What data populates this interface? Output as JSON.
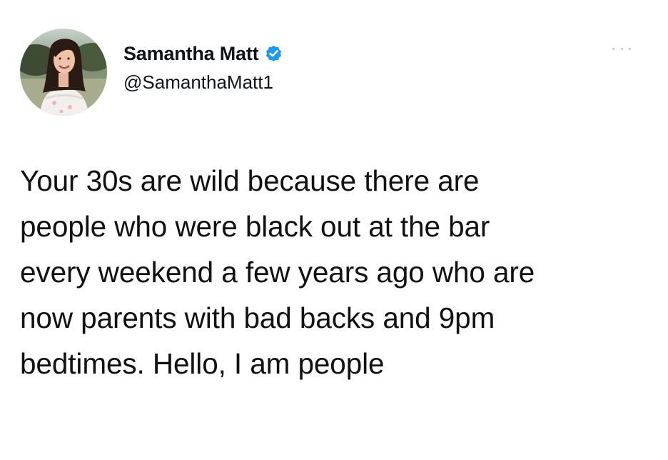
{
  "author": {
    "display_name": "Samantha Matt",
    "handle": "@SamanthaMatt1",
    "verified": true,
    "avatar_icon": "profile-photo",
    "verified_icon": "verified-badge-icon",
    "verified_color": "#1d9bf0"
  },
  "menu": {
    "icon": "more-options-icon"
  },
  "tweet": {
    "lines": [
      "Your 30s are wild because there are",
      "people who were black out at the bar",
      "every weekend a few years ago who are",
      "now parents with bad backs and 9pm",
      "bedtimes. Hello, I am people"
    ]
  },
  "colors": {
    "background": "#ffffff",
    "text": "#0f1419",
    "muted": "#b9c0c7"
  }
}
